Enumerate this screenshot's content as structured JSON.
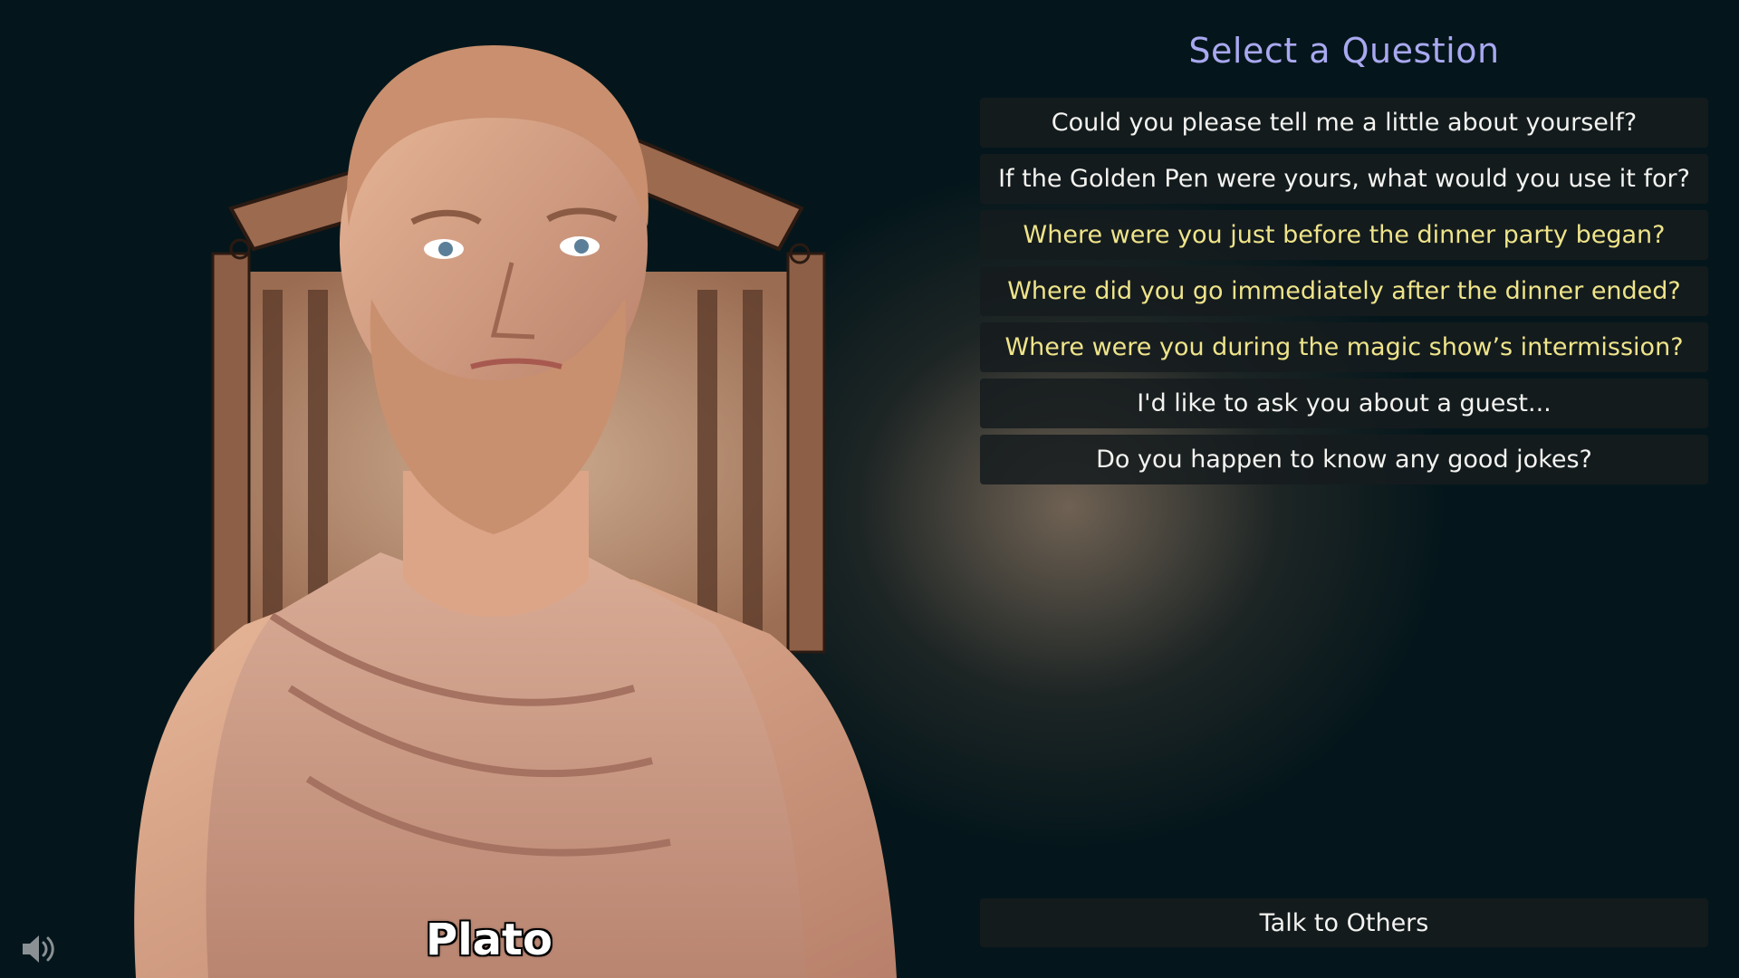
{
  "panel": {
    "title": "Select a Question",
    "questions": [
      {
        "label": "Could you please tell me a little about yourself?",
        "unread": false
      },
      {
        "label": "If the Golden Pen were yours, what would you use it for?",
        "unread": false
      },
      {
        "label": "Where were you just before the dinner party began?",
        "unread": true
      },
      {
        "label": "Where did you go immediately after the dinner ended?",
        "unread": true
      },
      {
        "label": "Where were you during the magic show’s intermission?",
        "unread": true
      },
      {
        "label": "I'd like to ask you about a guest...",
        "unread": false
      },
      {
        "label": "Do you happen to know any good jokes?",
        "unread": false
      }
    ],
    "talk_button": "Talk to Others"
  },
  "character": {
    "name": "Plato"
  },
  "controls": {
    "sound_icon": "speaker-volume-icon"
  },
  "colors": {
    "background": "#04161b",
    "title": "#a9a8f0",
    "question_text": "#f3f3f0",
    "unread_text": "#efe48a",
    "button_bg": "#161c1e"
  }
}
